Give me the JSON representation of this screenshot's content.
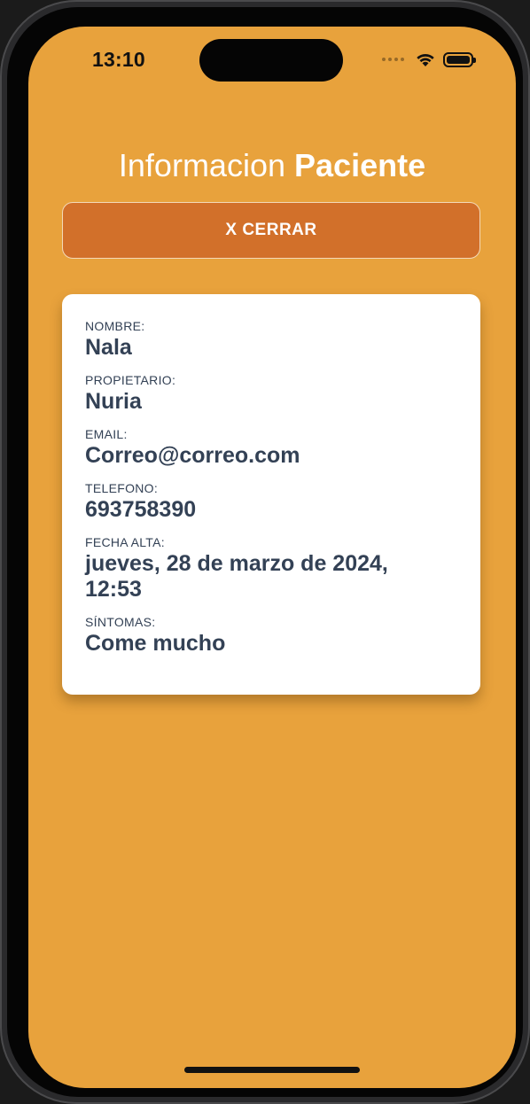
{
  "status_bar": {
    "time": "13:10",
    "icons": [
      "cellular-dots-icon",
      "wifi-icon",
      "battery-icon"
    ]
  },
  "header": {
    "title_regular": "Informacion",
    "title_bold": "Paciente"
  },
  "close_button": {
    "label": "X CERRAR"
  },
  "patient": {
    "nombre": {
      "label": "NOMBRE:",
      "value": "Nala"
    },
    "propietario": {
      "label": "PROPIETARIO:",
      "value": "Nuria"
    },
    "email": {
      "label": "EMAIL:",
      "value": "Correo@correo.com"
    },
    "telefono": {
      "label": "TELEFONO:",
      "value": "693758390"
    },
    "fecha_alta": {
      "label": "FECHA ALTA:",
      "value_line1": "jueves, 28 de marzo de 2024,",
      "value_line2": "12:53"
    },
    "sintomas": {
      "label": "SÍNTOMAS:",
      "value": "Come mucho"
    }
  },
  "colors": {
    "background": "#E8A23C",
    "button": "#D2702A",
    "card": "#FFFFFF",
    "text": "#334155"
  }
}
